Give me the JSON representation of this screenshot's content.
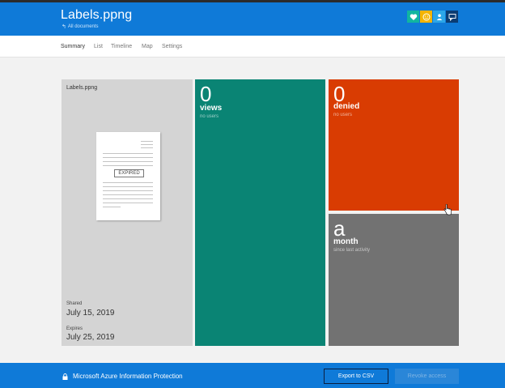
{
  "header": {
    "title": "Labels.ppng",
    "back_link": "All documents",
    "icons": [
      {
        "name": "heart-icon",
        "color": "#11b5a0"
      },
      {
        "name": "smiley-icon",
        "color": "#f4b400"
      },
      {
        "name": "person-icon",
        "color": "#2ca6e8"
      },
      {
        "name": "feedback-icon",
        "color": "#0b3c73"
      }
    ]
  },
  "nav": {
    "tabs": [
      {
        "label": "Summary",
        "active": true
      },
      {
        "label": "List",
        "active": false
      },
      {
        "label": "Timeline",
        "active": false
      },
      {
        "label": "Map",
        "active": false
      },
      {
        "label": "Settings",
        "active": false
      }
    ]
  },
  "document_tile": {
    "name": "Labels.ppng",
    "stamp": "EXPIRED",
    "shared_label": "Shared",
    "shared_date": "July 15, 2019",
    "expires_label": "Expires",
    "expires_date": "July 25, 2019",
    "color": "#d4d4d4"
  },
  "views_tile": {
    "value": "0",
    "label": "views",
    "sublabel": "no users",
    "color": "#0a8474"
  },
  "denied_tile": {
    "value": "0",
    "label": "denied",
    "sublabel": "no users",
    "color": "#d93c02"
  },
  "month_tile": {
    "value": "a",
    "label": "month",
    "sublabel": "since last activity",
    "color": "#727272"
  },
  "footer": {
    "product": "Microsoft Azure Information Protection",
    "export_label": "Export to CSV",
    "revoke_label": "Revoke access",
    "revoke_enabled": false
  },
  "colors": {
    "accent": "#0f7ad8"
  }
}
